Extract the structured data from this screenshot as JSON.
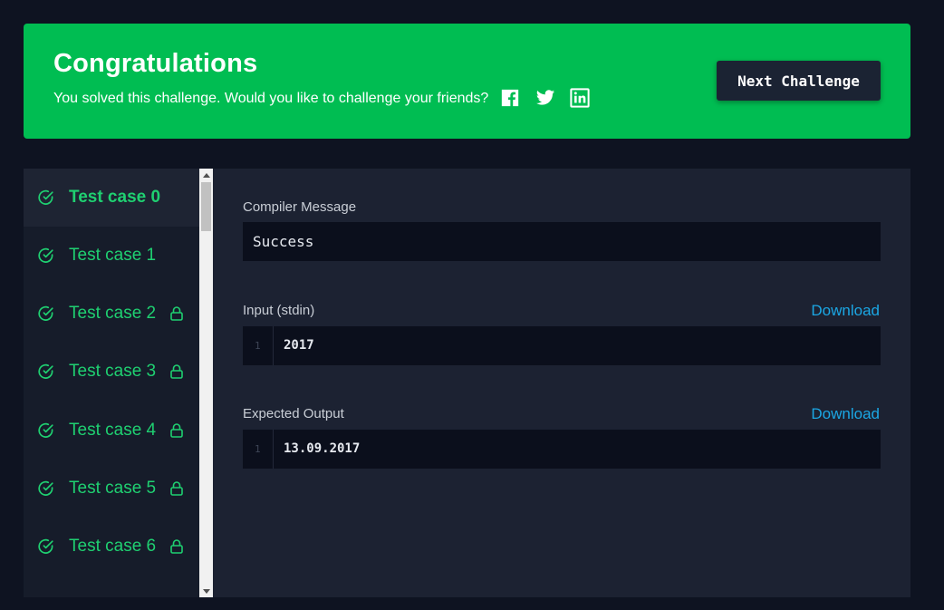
{
  "banner": {
    "title": "Congratulations",
    "subtitle": "You solved this challenge. Would you like to challenge your friends?",
    "social": [
      "facebook-icon",
      "twitter-icon",
      "linkedin-icon"
    ],
    "next_button": "Next Challenge",
    "color": "#00bd52"
  },
  "test_cases": [
    {
      "label": "Test case 0",
      "passed": true,
      "locked": false,
      "active": true
    },
    {
      "label": "Test case 1",
      "passed": true,
      "locked": false,
      "active": false
    },
    {
      "label": "Test case 2",
      "passed": true,
      "locked": true,
      "active": false
    },
    {
      "label": "Test case 3",
      "passed": true,
      "locked": true,
      "active": false
    },
    {
      "label": "Test case 4",
      "passed": true,
      "locked": true,
      "active": false
    },
    {
      "label": "Test case 5",
      "passed": true,
      "locked": true,
      "active": false
    },
    {
      "label": "Test case 6",
      "passed": true,
      "locked": true,
      "active": false
    }
  ],
  "compiler": {
    "label": "Compiler Message",
    "message": "Success"
  },
  "input": {
    "label": "Input (stdin)",
    "download": "Download",
    "line_number": "1",
    "value": "2017"
  },
  "expected": {
    "label": "Expected Output",
    "download": "Download",
    "line_number": "1",
    "value": "13.09.2017"
  },
  "colors": {
    "accent_green": "#1fd071",
    "link_blue": "#1ba7e4",
    "background": "#0e1321"
  }
}
